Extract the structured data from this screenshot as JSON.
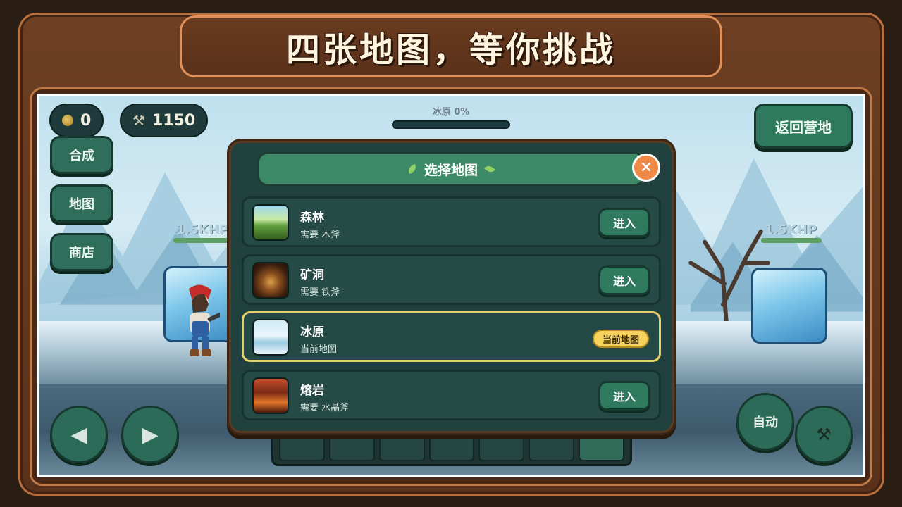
{
  "title": "四张地图，等你挑战",
  "hud": {
    "coins": "0",
    "axe_power": "1150",
    "progress_label": "冰原 0%",
    "progress_fraction": 0.0,
    "return_button": "返回营地"
  },
  "side_menu": [
    "合成",
    "地图",
    "商店"
  ],
  "enemies": [
    {
      "hp_label": "1.5KHP"
    },
    {
      "hp_label": "1.5KHP"
    }
  ],
  "controls": {
    "left": "◀",
    "right": "▶",
    "auto": "自动"
  },
  "modal": {
    "title": "选择地图",
    "close": "×",
    "maps": [
      {
        "name": "森林",
        "sub": "需要 木斧",
        "action": "进入",
        "thumb": "forest"
      },
      {
        "name": "矿洞",
        "sub": "需要 铁斧",
        "action": "进入",
        "thumb": "mine"
      },
      {
        "name": "冰原",
        "sub": "当前地图",
        "action": "当前地图",
        "thumb": "ice",
        "current": true
      },
      {
        "name": "熔岩",
        "sub": "需要 水晶斧",
        "action": "进入",
        "thumb": "lava"
      }
    ]
  },
  "colors": {
    "accent_green": "#2f7a5f",
    "badge_yellow": "#f6d35c",
    "close_orange": "#ee8a45",
    "frame_brown": "#6e3f22"
  }
}
